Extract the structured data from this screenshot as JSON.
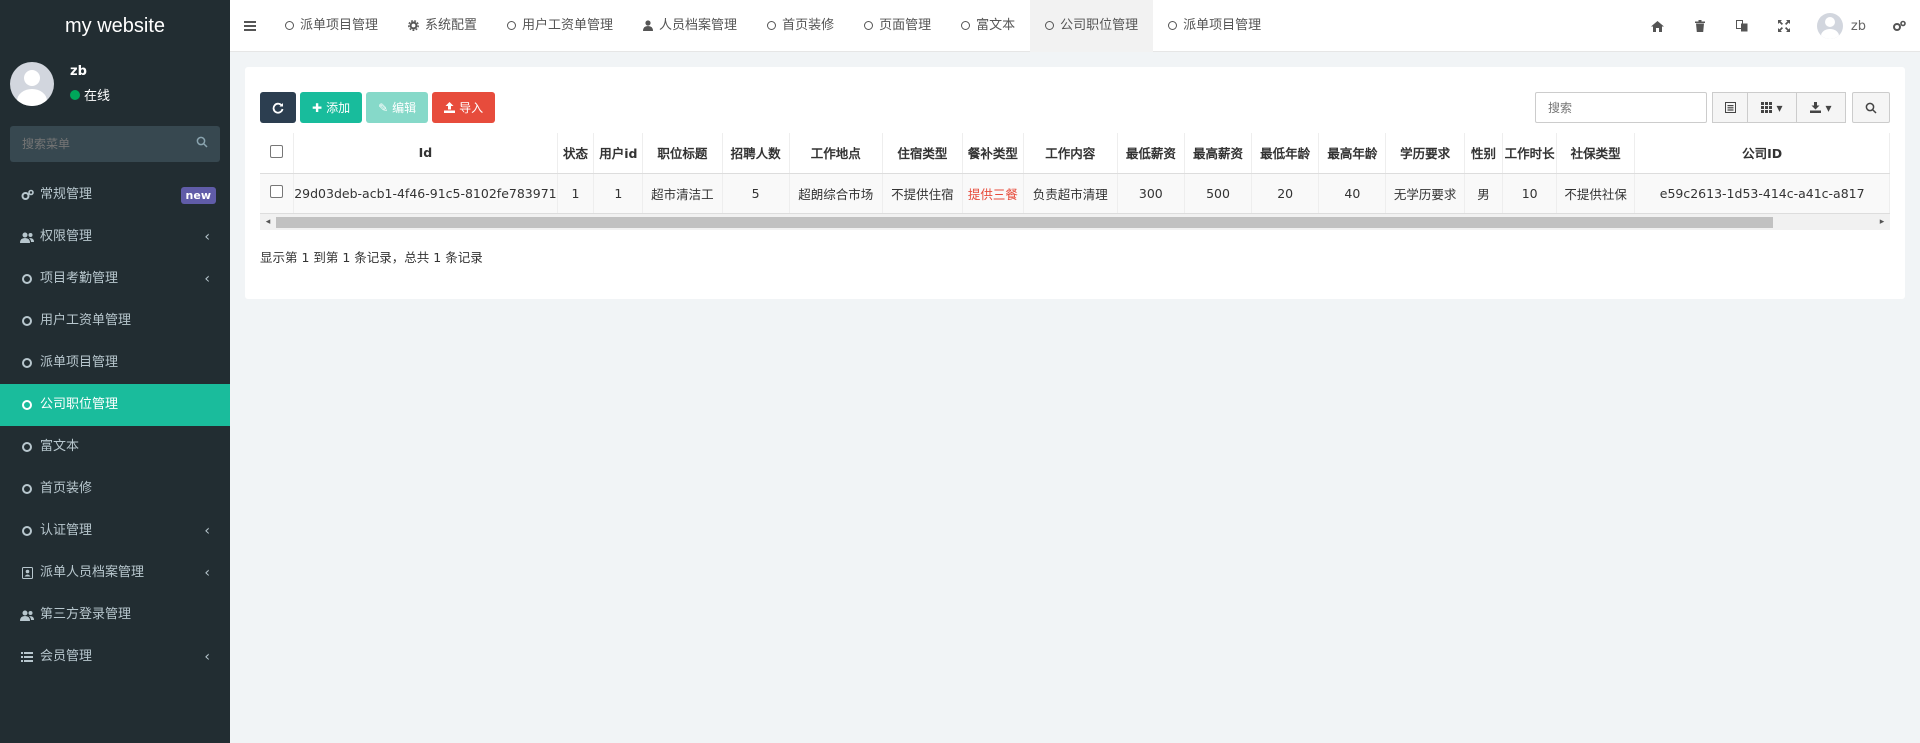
{
  "sidebar": {
    "brand": "my website",
    "user": {
      "name": "zb",
      "status": "在线"
    },
    "search_placeholder": "搜索菜单",
    "items": [
      {
        "label": "常规管理",
        "icon": "cogs-icon",
        "badge": "new"
      },
      {
        "label": "权限管理",
        "icon": "users-icon",
        "chevron": "‹"
      },
      {
        "label": "项目考勤管理",
        "icon": "circle-icon",
        "chevron": "‹"
      },
      {
        "label": "用户工资单管理",
        "icon": "circle-icon"
      },
      {
        "label": "派单项目管理",
        "icon": "circle-icon"
      },
      {
        "label": "公司职位管理",
        "icon": "circle-icon",
        "active": true
      },
      {
        "label": "富文本",
        "icon": "circle-icon"
      },
      {
        "label": "首页装修",
        "icon": "circle-icon"
      },
      {
        "label": "认证管理",
        "icon": "circle-icon",
        "chevron": "‹"
      },
      {
        "label": "派单人员档案管理",
        "icon": "id-card-icon",
        "chevron": "‹"
      },
      {
        "label": "第三方登录管理",
        "icon": "users-icon"
      },
      {
        "label": "会员管理",
        "icon": "list-icon",
        "chevron": "‹"
      }
    ]
  },
  "topbar": {
    "tabs": [
      {
        "label": "派单项目管理",
        "icon": "circle-icon"
      },
      {
        "label": "系统配置",
        "icon": "gear-icon"
      },
      {
        "label": "用户工资单管理",
        "icon": "circle-icon"
      },
      {
        "label": "人员档案管理",
        "icon": "user-icon"
      },
      {
        "label": "首页装修",
        "icon": "circle-icon"
      },
      {
        "label": "页面管理",
        "icon": "circle-icon"
      },
      {
        "label": "富文本",
        "icon": "circle-icon"
      },
      {
        "label": "公司职位管理",
        "icon": "circle-icon",
        "active": true
      },
      {
        "label": "派单项目管理",
        "icon": "circle-icon"
      }
    ],
    "user_name": "zb"
  },
  "toolbar": {
    "add_label": "添加",
    "edit_label": "编辑",
    "import_label": "导入",
    "search_placeholder": "搜索"
  },
  "table": {
    "columns": [
      "Id",
      "状态",
      "用户id",
      "职位标题",
      "招聘人数",
      "工作地点",
      "住宿类型",
      "餐补类型",
      "工作内容",
      "最低薪资",
      "最高薪资",
      "最低年龄",
      "最高年龄",
      "学历要求",
      "性别",
      "工作时长",
      "社保类型",
      "公司ID"
    ],
    "rows": [
      [
        "29d03deb-acb1-4f46-91c5-8102fe783971",
        "1",
        "1",
        "超市清洁工",
        "5",
        "超朗综合市场",
        "不提供住宿",
        "提供三餐",
        "负责超市清理",
        "300",
        "500",
        "20",
        "40",
        "无学历要求",
        "男",
        "10",
        "不提供社保",
        "e59c2613-1d53-414c-a41c-a817"
      ]
    ]
  },
  "footer": {
    "info": "显示第 1 到第 1 条记录，总共 1 条记录"
  },
  "colors": {
    "sidebar_bg": "#222d32",
    "active_bg": "#1abc9c",
    "accent_red": "#e74c3c"
  }
}
